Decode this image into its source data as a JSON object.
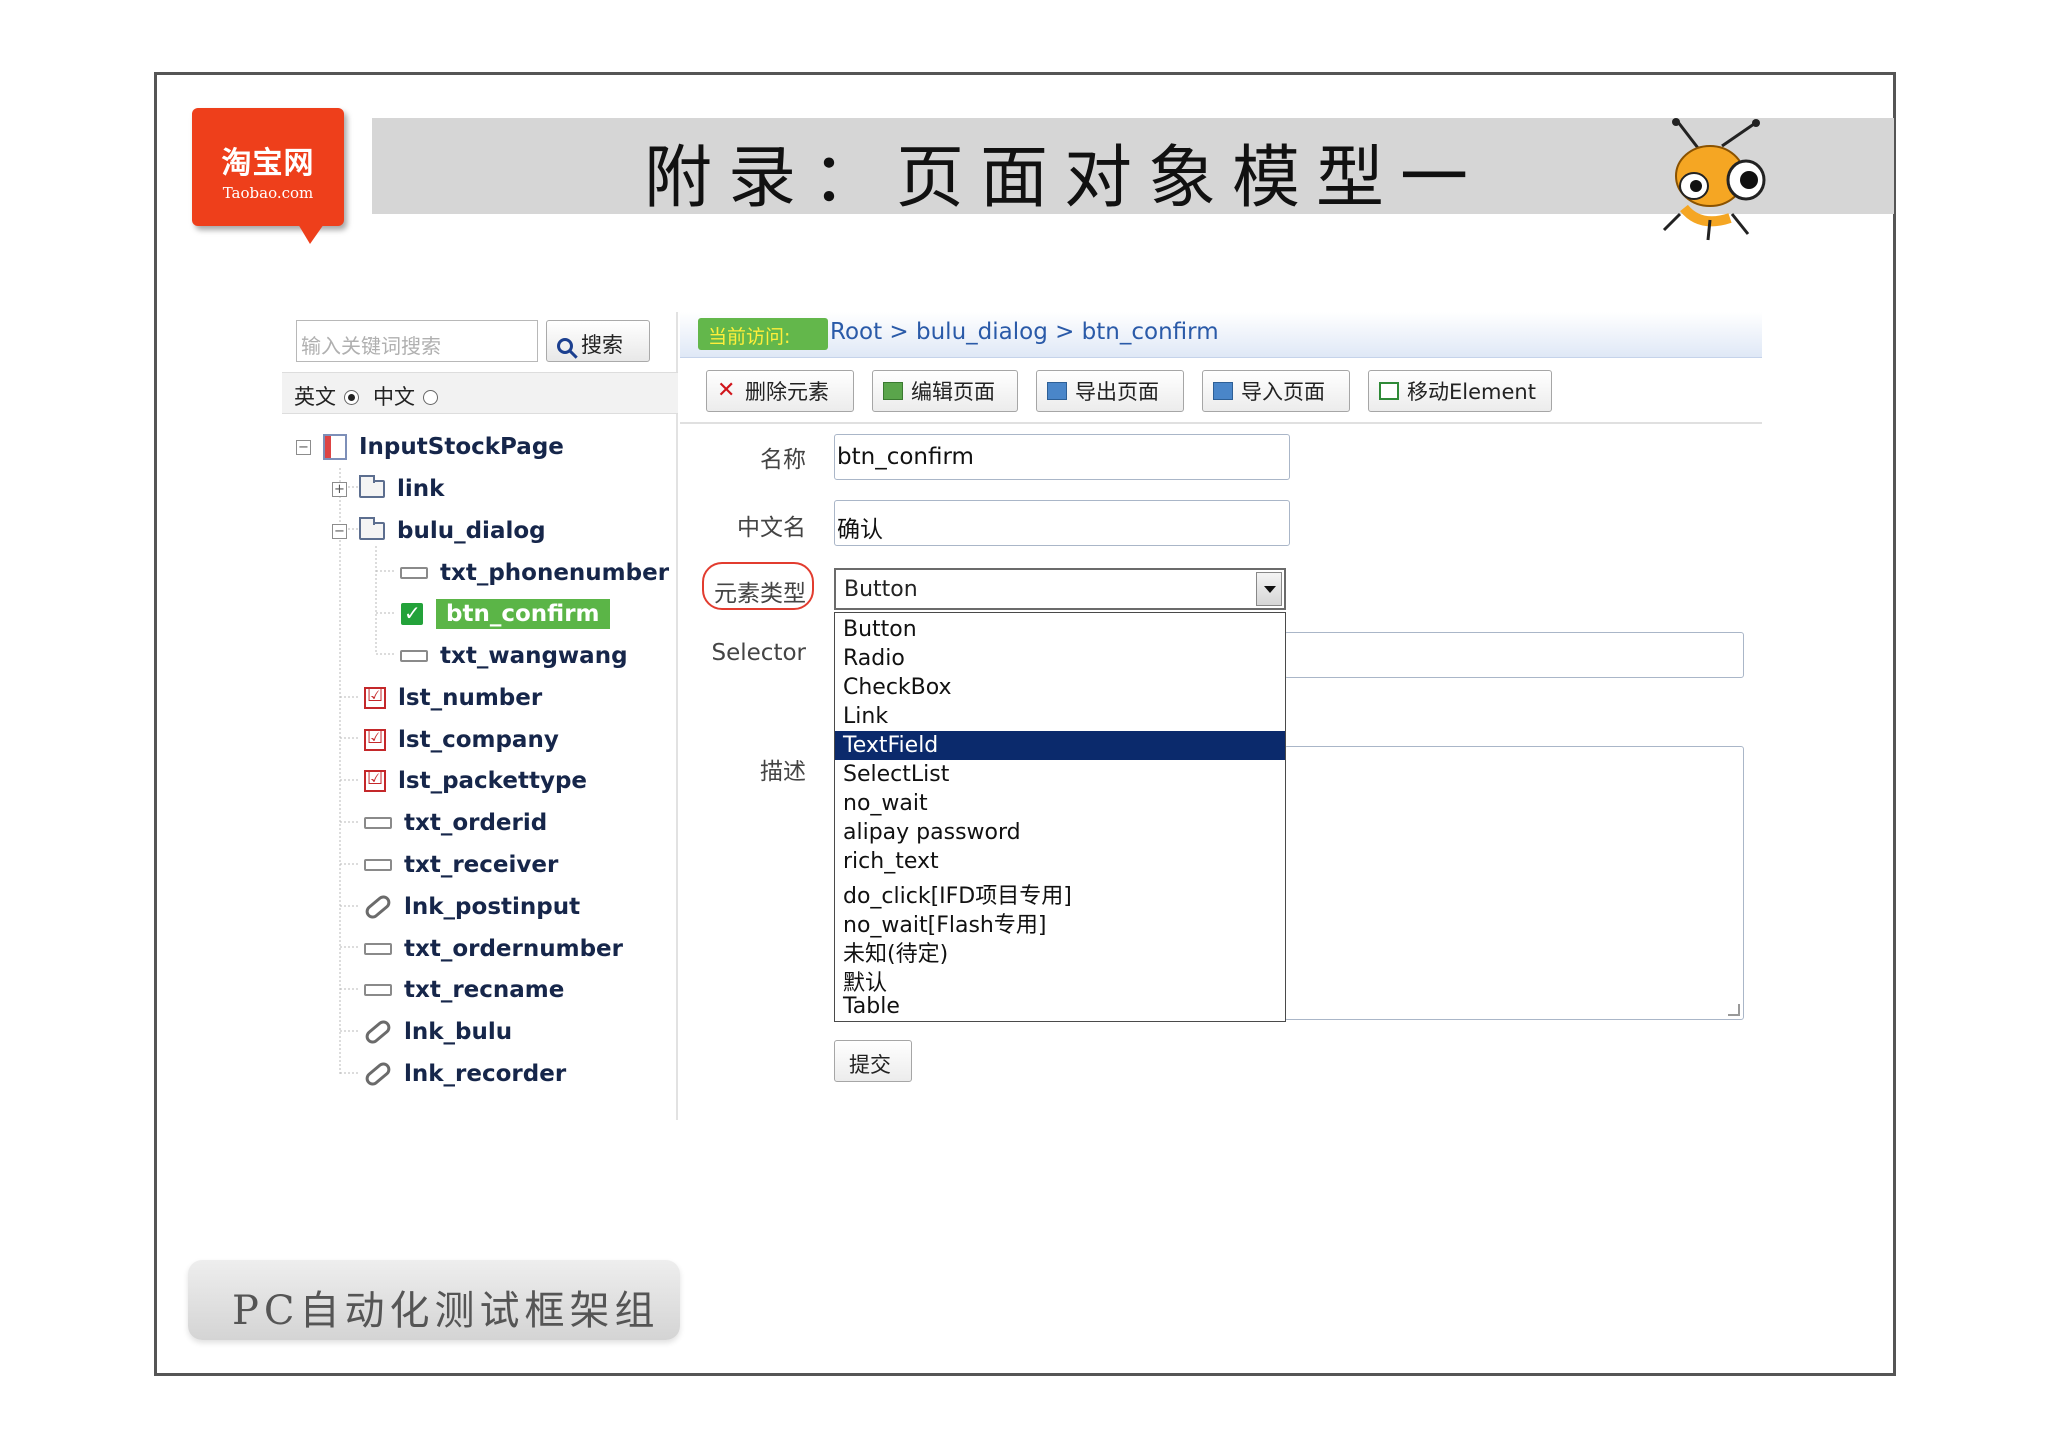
{
  "header": {
    "logo_cn": "淘宝网",
    "logo_en": "Taobao.com",
    "title": "附录：页面对象模型一",
    "brand_color": "#ee3f1b"
  },
  "search": {
    "placeholder": "输入关键词搜索",
    "button_label": "搜索"
  },
  "language": {
    "english_label": "英文",
    "chinese_label": "中文",
    "selected": "英文"
  },
  "tree": {
    "root": "InputStockPage",
    "nodes": [
      {
        "label": "link",
        "icon": "folder-icon"
      },
      {
        "label": "bulu_dialog",
        "icon": "folder-icon"
      },
      {
        "label": "txt_phonenumber",
        "icon": "textfield-icon"
      },
      {
        "label": "btn_confirm",
        "icon": "checkbox-icon"
      },
      {
        "label": "txt_wangwang",
        "icon": "textfield-icon"
      },
      {
        "label": "lst_number",
        "icon": "list-icon"
      },
      {
        "label": "lst_company",
        "icon": "list-icon"
      },
      {
        "label": "lst_packettype",
        "icon": "list-icon"
      },
      {
        "label": "txt_orderid",
        "icon": "textfield-icon"
      },
      {
        "label": "txt_receiver",
        "icon": "textfield-icon"
      },
      {
        "label": "lnk_postinput",
        "icon": "link-icon"
      },
      {
        "label": "txt_ordernumber",
        "icon": "textfield-icon"
      },
      {
        "label": "txt_recname",
        "icon": "textfield-icon"
      },
      {
        "label": "lnk_bulu",
        "icon": "link-icon"
      },
      {
        "label": "lnk_recorder",
        "icon": "link-icon"
      }
    ],
    "selected_color": "#5bb547"
  },
  "breadcrumb": {
    "badge": "当前访问:",
    "path": "Root > bulu_dialog > btn_confirm"
  },
  "toolbar": {
    "delete": "删除元素",
    "edit": "编辑页面",
    "export": "导出页面",
    "import": "导入页面",
    "move": "移动Element"
  },
  "form": {
    "name_label": "名称",
    "name_value": "btn_confirm",
    "cn_name_label": "中文名",
    "cn_name_value": "确认",
    "type_label": "元素类型",
    "type_value": "Button",
    "selector_label": "Selector",
    "desc_label": "描述",
    "submit_label": "提交"
  },
  "type_options": [
    "Button",
    "Radio",
    "CheckBox",
    "Link",
    "TextField",
    "SelectList",
    "no_wait",
    "alipay password",
    "rich_text",
    "do_click[IFD项目专用]",
    "no_wait[Flash专用]",
    "未知(待定)",
    "默认",
    "Table"
  ],
  "highlighted_option": "TextField",
  "footer": {
    "label": "PC自动化测试框架组"
  }
}
